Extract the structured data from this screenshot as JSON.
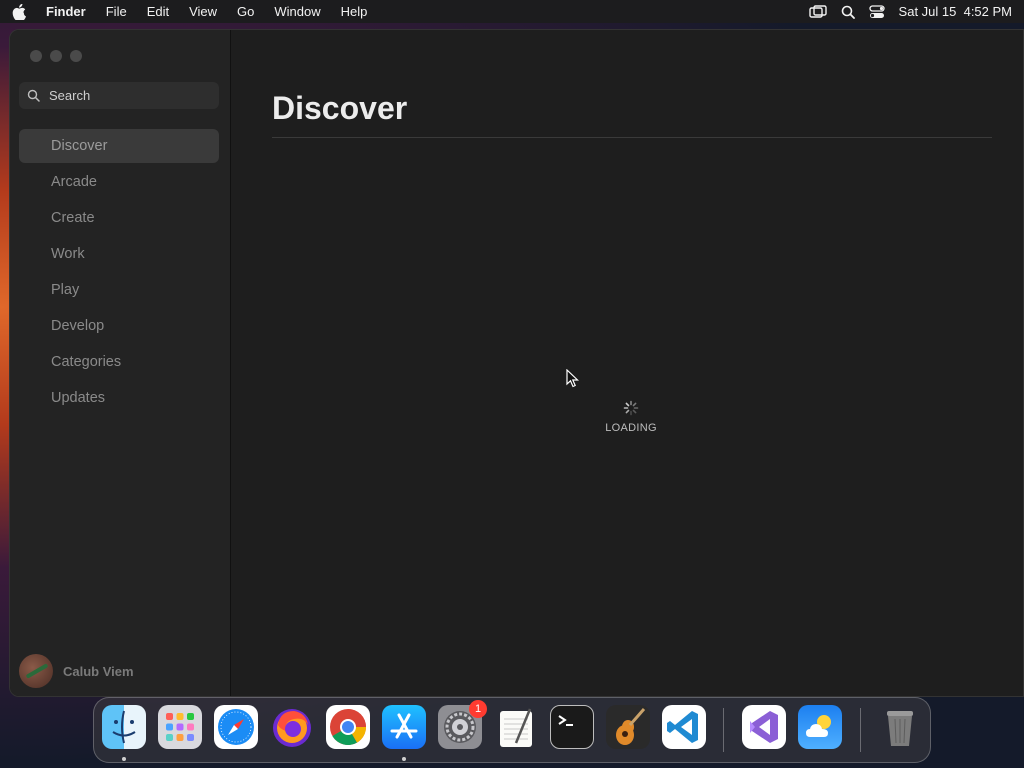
{
  "menubar": {
    "app_name": "Finder",
    "items": [
      "File",
      "Edit",
      "View",
      "Go",
      "Window",
      "Help"
    ],
    "datetime": "Sat Jul 15  4:52 PM"
  },
  "sidebar": {
    "search_placeholder": "Search",
    "items": [
      {
        "label": "Discover",
        "active": true
      },
      {
        "label": "Arcade"
      },
      {
        "label": "Create"
      },
      {
        "label": "Work"
      },
      {
        "label": "Play"
      },
      {
        "label": "Develop"
      },
      {
        "label": "Categories"
      },
      {
        "label": "Updates"
      }
    ],
    "user_name": "Calub Viem"
  },
  "main": {
    "title": "Discover",
    "loading_text": "LOADING"
  },
  "dock": {
    "apps": [
      "finder-icon",
      "launchpad-icon",
      "safari-icon",
      "firefox-icon",
      "chrome-icon",
      "app-store-icon",
      "system-settings-icon",
      "textedit-icon",
      "terminal-icon",
      "garageband-icon",
      "vscode-icon",
      "visual-studio-icon",
      "weather-icon",
      "trash-icon"
    ],
    "settings_badge": "1",
    "running_apps": [
      "finder-icon",
      "app-store-icon"
    ]
  }
}
